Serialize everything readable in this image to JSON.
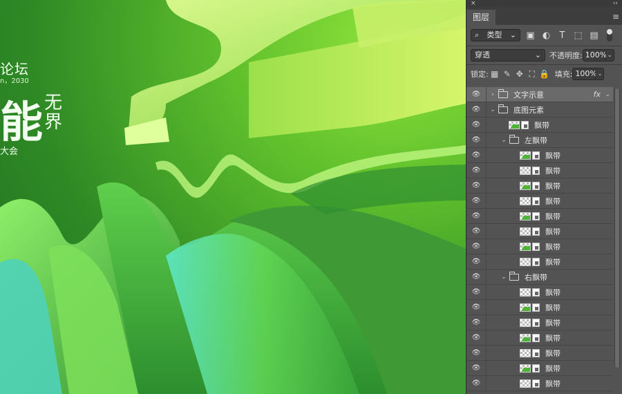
{
  "window": {
    "close_glyph": "×",
    "collapse_glyph": "‹‹"
  },
  "poster": {
    "title_line1": "论坛",
    "subtitle_line": "n，2030",
    "big_char": "能",
    "side_chars": "无界",
    "bottom_line": "大会"
  },
  "panel": {
    "tab_label": "图层",
    "filter": {
      "kind_label": "类型",
      "icons": [
        "image-filter-icon",
        "adjustment-filter-icon",
        "type-filter-icon",
        "shape-filter-icon",
        "smart-object-filter-icon"
      ]
    },
    "blend": {
      "mode": "穿透",
      "opacity_label": "不透明度:",
      "opacity_value": "100%"
    },
    "lock": {
      "label": "锁定:",
      "fill_label": "填充:",
      "fill_value": "100%"
    },
    "layers": [
      {
        "name": "文字示意",
        "type": "group",
        "depth": 0,
        "expanded": false,
        "selected": true,
        "fx": "fx"
      },
      {
        "name": "底图元素",
        "type": "group",
        "depth": 0,
        "expanded": true
      },
      {
        "name": "飘带",
        "type": "layer",
        "depth": 1
      },
      {
        "name": "左飘带",
        "type": "group",
        "depth": 1,
        "expanded": true
      },
      {
        "name": "飘带",
        "type": "layer",
        "depth": 2
      },
      {
        "name": "飘带",
        "type": "layer",
        "depth": 2
      },
      {
        "name": "飘带",
        "type": "layer",
        "depth": 2
      },
      {
        "name": "飘带",
        "type": "layer",
        "depth": 2
      },
      {
        "name": "飘带",
        "type": "layer",
        "depth": 2
      },
      {
        "name": "飘带",
        "type": "layer",
        "depth": 2
      },
      {
        "name": "飘带",
        "type": "layer",
        "depth": 2
      },
      {
        "name": "飘带",
        "type": "layer",
        "depth": 2
      },
      {
        "name": "右飘带",
        "type": "group",
        "depth": 1,
        "expanded": true
      },
      {
        "name": "飘带",
        "type": "layer",
        "depth": 2
      },
      {
        "name": "飘带",
        "type": "layer",
        "depth": 2
      },
      {
        "name": "飘带",
        "type": "layer",
        "depth": 2
      },
      {
        "name": "飘带",
        "type": "layer",
        "depth": 2
      },
      {
        "name": "飘带",
        "type": "layer",
        "depth": 2
      },
      {
        "name": "飘带",
        "type": "layer",
        "depth": 2
      },
      {
        "name": "飘带",
        "type": "layer",
        "depth": 2
      }
    ]
  }
}
